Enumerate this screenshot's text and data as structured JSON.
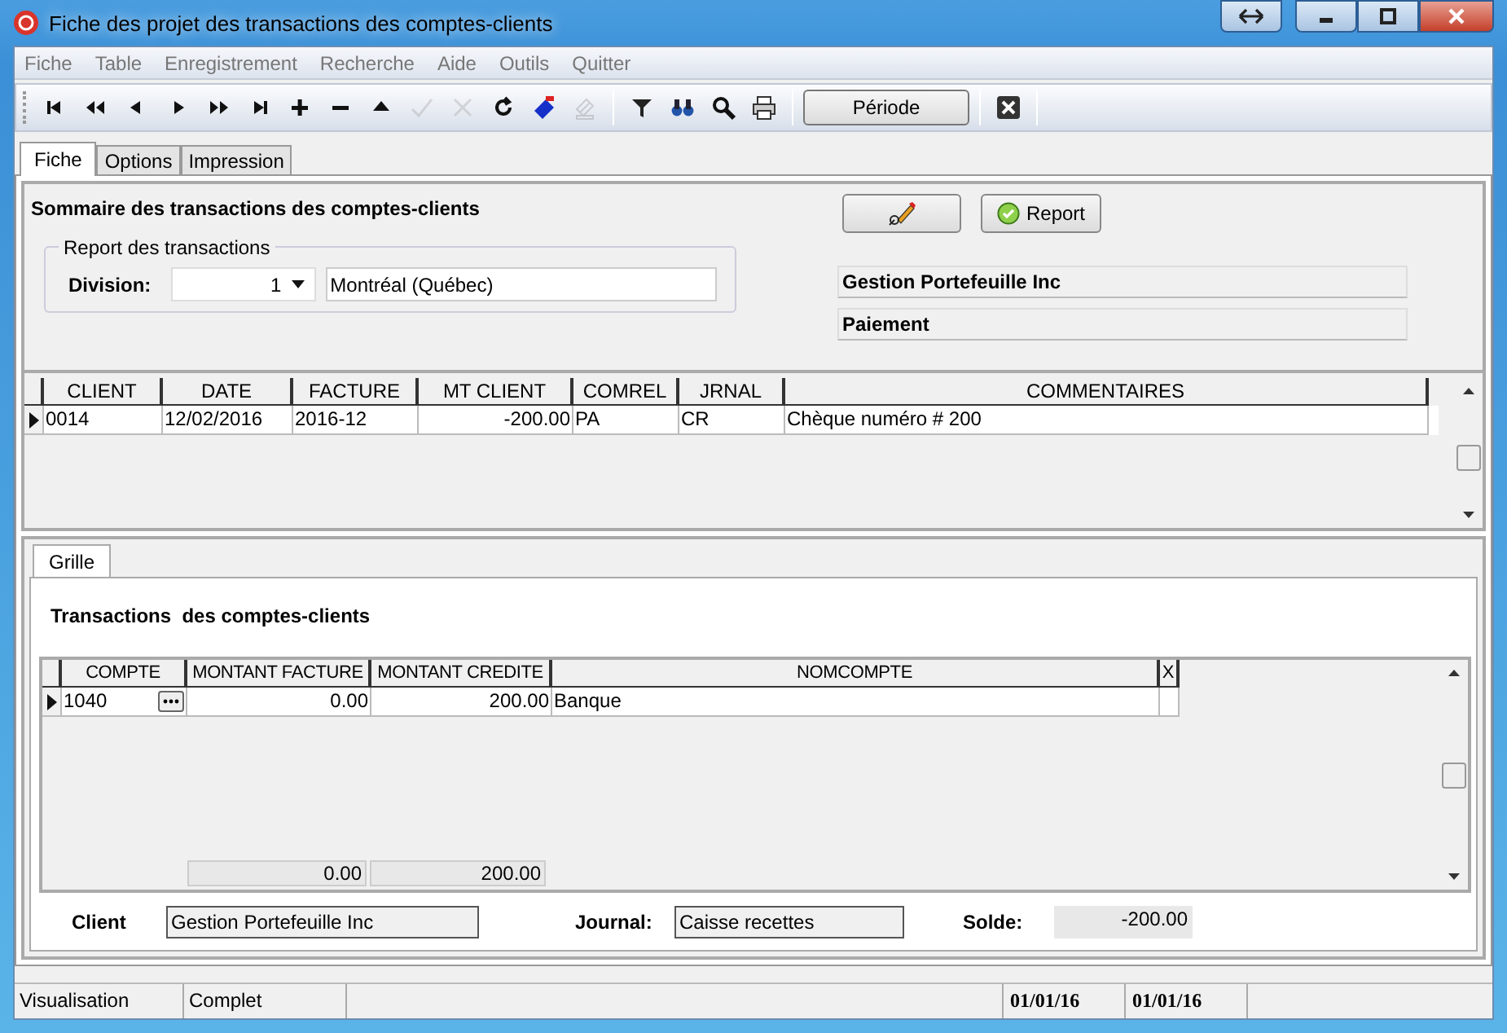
{
  "window": {
    "title": "Fiche des projet des transactions des comptes-clients"
  },
  "menu": [
    "Fiche",
    "Table",
    "Enregistrement",
    "Recherche",
    "Aide",
    "Outils",
    "Quitter"
  ],
  "toolbar": [
    {
      "kind": "first",
      "disabled": false
    },
    {
      "kind": "prev-page",
      "disabled": false
    },
    {
      "kind": "prev",
      "disabled": false
    },
    {
      "kind": "next",
      "disabled": false
    },
    {
      "kind": "next-page",
      "disabled": false
    },
    {
      "kind": "last",
      "disabled": false
    },
    {
      "kind": "add",
      "disabled": false
    },
    {
      "kind": "delete",
      "disabled": false
    },
    {
      "kind": "up",
      "disabled": false
    },
    {
      "kind": "post",
      "disabled": true
    },
    {
      "kind": "cancel",
      "disabled": true
    },
    {
      "kind": "refresh",
      "disabled": false
    },
    {
      "kind": "tag",
      "disabled": false
    },
    {
      "kind": "goto",
      "disabled": true
    },
    {
      "kind": "sep"
    },
    {
      "kind": "filter",
      "disabled": false
    },
    {
      "kind": "binoculars",
      "disabled": false
    },
    {
      "kind": "search",
      "disabled": false
    },
    {
      "kind": "print",
      "disabled": false
    },
    {
      "kind": "sep"
    },
    {
      "kind": "button",
      "label": "Période"
    },
    {
      "kind": "sep"
    },
    {
      "kind": "close",
      "disabled": false
    }
  ],
  "tabs": [
    {
      "label": "Fiche",
      "selected": true
    },
    {
      "label": "Options",
      "selected": false
    },
    {
      "label": "Impression",
      "selected": false
    }
  ],
  "summary": {
    "title": "Sommaire des transactions des comptes-clients",
    "report_button": "Report",
    "group_title": "Report des transactions",
    "division_label": "Division:",
    "division_value": "1",
    "division_name": "Montréal (Québec)",
    "company": "Gestion Portefeuille Inc",
    "type": "Paiement"
  },
  "grid": {
    "columns": [
      "CLIENT",
      "DATE",
      "FACTURE",
      "MT CLIENT",
      "COMREL",
      "JRNAL",
      "COMMENTAIRES"
    ],
    "rows": [
      {
        "selected": true,
        "cells": [
          "0014",
          "12/02/2016",
          "2016-12",
          "-200.00",
          "PA",
          "CR",
          "Chèque numéro # 200"
        ]
      }
    ]
  },
  "subtabs": [
    {
      "label": "Grille",
      "selected": true
    }
  ],
  "detail": {
    "title": "Transactions  des comptes-clients",
    "columns": [
      "COMPTE",
      "MONTANT FACTURE",
      "MONTANT CREDITE",
      "NOMCOMPTE",
      "X"
    ],
    "rows": [
      {
        "selected": true,
        "cells": [
          "1040",
          "0.00",
          "200.00",
          "Banque",
          ""
        ]
      }
    ],
    "totals": [
      "0.00",
      "200.00"
    ]
  },
  "footer": {
    "client_label": "Client",
    "client_value": "Gestion Portefeuille Inc",
    "journal_label": "Journal:",
    "journal_value": "Caisse recettes",
    "balance_label": "Solde:",
    "balance_value": "-200.00"
  },
  "status_bar": [
    "Visualisation",
    "Complet",
    "01/01/16",
    "01/01/16"
  ]
}
